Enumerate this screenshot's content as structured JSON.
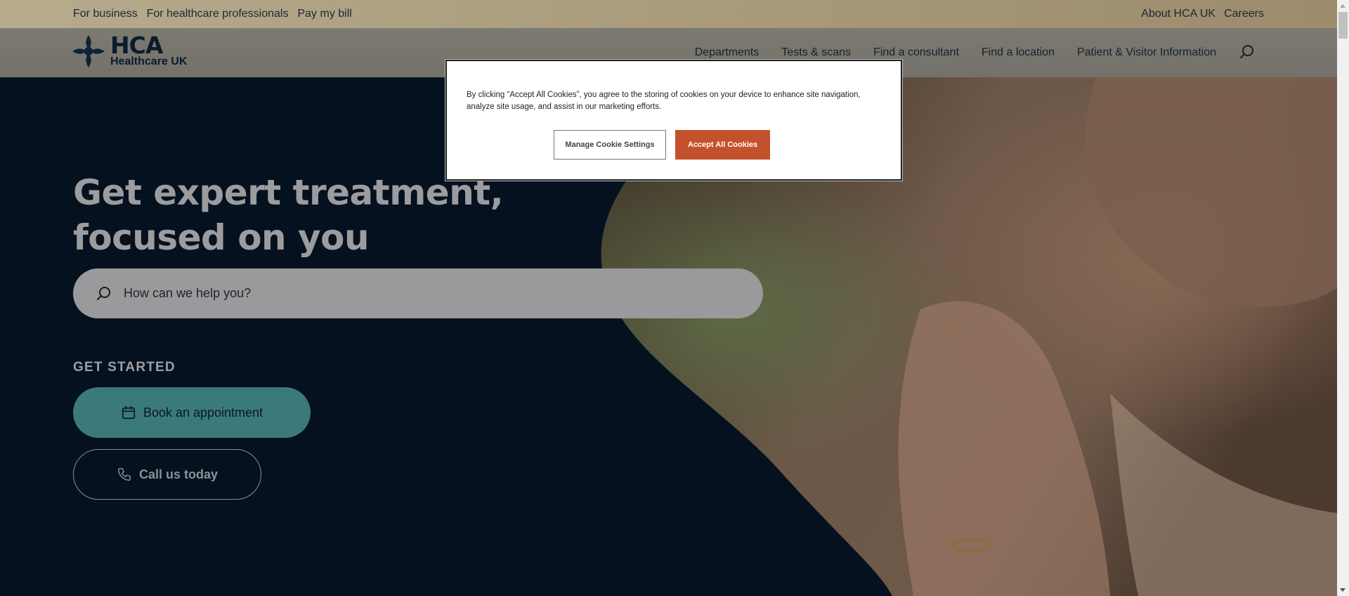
{
  "utility_bar": {
    "left_links": [
      "For business",
      "For healthcare professionals",
      "Pay my bill"
    ],
    "right_links": [
      "About HCA UK",
      "Careers"
    ]
  },
  "header": {
    "logo_title": "HCA",
    "logo_subtitle": "Healthcare UK",
    "nav": [
      "Departments",
      "Tests & scans",
      "Find a consultant",
      "Find a location",
      "Patient & Visitor Information"
    ]
  },
  "hero": {
    "title_line1": "Get expert treatment,",
    "title_line2": "focused on you",
    "search_placeholder": "How can we help you?",
    "get_started": "GET STARTED",
    "book_label": "Book an appointment",
    "call_label": "Call us today"
  },
  "cookie_banner": {
    "text": "By clicking “Accept All Cookies”, you agree to the storing of cookies on your device to enhance site navigation, analyze site usage, and assist in our marketing efforts.",
    "manage_label": "Manage Cookie Settings",
    "accept_label": "Accept All Cookies"
  },
  "colors": {
    "brand_navy": "#05111f",
    "accent_teal": "#3a7a7b",
    "cookie_accept": "#c4512d"
  },
  "icons": {
    "search": "search-icon",
    "calendar": "calendar-icon",
    "phone": "phone-icon",
    "logo": "hca-cross-logo-icon"
  }
}
